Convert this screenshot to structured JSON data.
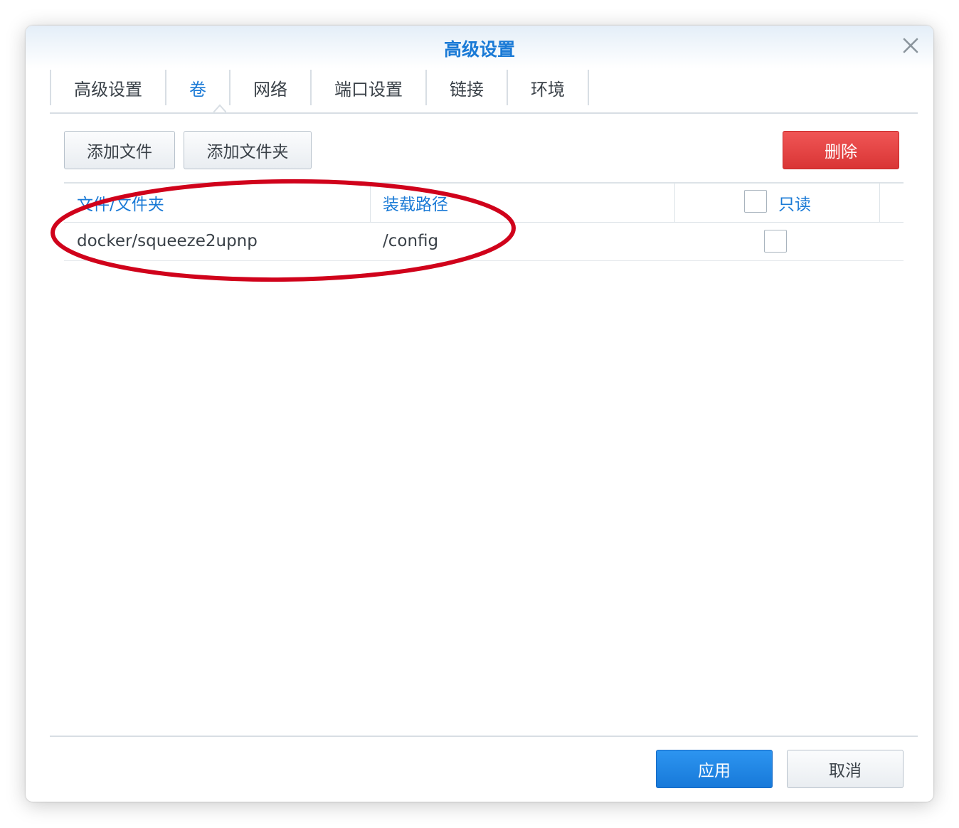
{
  "dialog": {
    "title": "高级设置",
    "close_icon": "close-icon"
  },
  "tabs": [
    {
      "label": "高级设置",
      "active": false
    },
    {
      "label": "卷",
      "active": true
    },
    {
      "label": "网络",
      "active": false
    },
    {
      "label": "端口设置",
      "active": false
    },
    {
      "label": "链接",
      "active": false
    },
    {
      "label": "环境",
      "active": false
    }
  ],
  "toolbar": {
    "add_file_label": "添加文件",
    "add_folder_label": "添加文件夹",
    "delete_label": "删除"
  },
  "table": {
    "columns": [
      "文件/文件夹",
      "装载路径",
      "只读"
    ],
    "rows": [
      {
        "file": "docker/squeeze2upnp",
        "mount_path": "/config",
        "read_only": false
      }
    ]
  },
  "footer": {
    "apply_label": "应用",
    "cancel_label": "取消"
  },
  "colors": {
    "accent": "#1a7ad6",
    "danger": "#e04444",
    "primary": "#1f86e8",
    "annotation": "#d0021b"
  }
}
